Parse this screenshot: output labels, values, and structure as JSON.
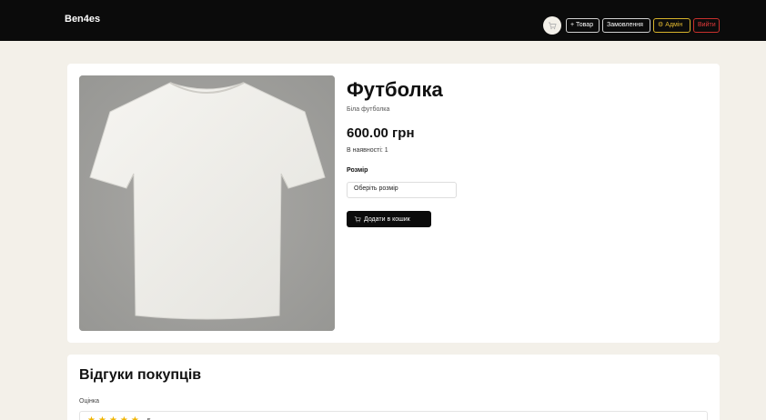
{
  "header": {
    "brand": "Ben4es",
    "cart_icon": "cart-icon",
    "add_product": "+ Товар",
    "orders": "Замовлення",
    "admin_icon": "gear-icon",
    "admin": "Адмін",
    "logout": "Вийти",
    "colors": {
      "bar": "#0b0b0b",
      "admin": "#e0b830",
      "logout": "#e33b3b"
    }
  },
  "product": {
    "title": "Футболка",
    "description": "Біла футболка",
    "price": "600.00 грн",
    "stock": "В наявності: 1",
    "size_label": "Розмір",
    "size_placeholder": "Оберіть розмір",
    "add_to_cart": "Додати в кошик"
  },
  "reviews": {
    "title": "Відгуки покупців",
    "rating_label": "Оцінка",
    "stars": 5,
    "rating_value": "5"
  }
}
